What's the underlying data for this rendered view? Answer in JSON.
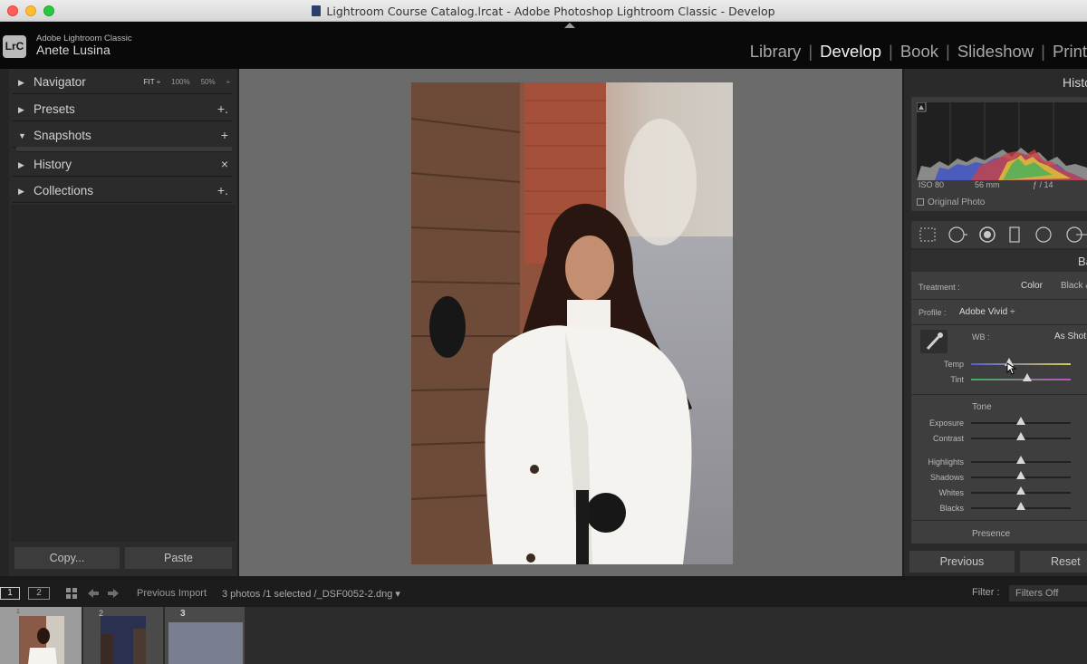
{
  "window": {
    "title": "Lightroom Course Catalog.lrcat - Adobe Photoshop Lightroom Classic - Develop"
  },
  "app": {
    "logo": "LrC",
    "name": "Adobe Lightroom Classic",
    "user": "Anete Lusina"
  },
  "modules": {
    "library": "Library",
    "develop": "Develop",
    "book": "Book",
    "slideshow": "Slideshow",
    "print": "Print",
    "active": "Develop"
  },
  "left_panel": {
    "navigator": {
      "label": "Navigator",
      "fit": "FIT ÷",
      "zoom_100": "100%",
      "zoom_50": "50%",
      "arrow": "÷"
    },
    "presets": {
      "label": "Presets",
      "action": "+."
    },
    "snapshots": {
      "label": "Snapshots",
      "action": "+"
    },
    "history": {
      "label": "History",
      "action": "×"
    },
    "collections": {
      "label": "Collections",
      "action": "+."
    },
    "copy_label": "Copy...",
    "paste_label": "Paste"
  },
  "right_panel": {
    "histogram_title": "Histogram",
    "meta": {
      "iso": "ISO 80",
      "focal": "56 mm",
      "aperture": "ƒ / 14"
    },
    "original_photo": "Original Photo",
    "basic_title": "Basic",
    "treatment": {
      "label": "Treatment :",
      "color": "Color",
      "bw": "Black & White"
    },
    "profile": {
      "label": "Profile :",
      "value": "Adobe Vivid ÷"
    },
    "wb": {
      "label": "WB :",
      "value": "As Shot"
    },
    "tone_label": "Tone",
    "presence_label": "Presence",
    "sliders": [
      {
        "label": "Temp",
        "value": 0.38
      },
      {
        "label": "Tint",
        "value": 0.56
      },
      {
        "label": "Exposure",
        "value": 0.5
      },
      {
        "label": "Contrast",
        "value": 0.5
      },
      {
        "label": "Highlights",
        "value": 0.5
      },
      {
        "label": "Shadows",
        "value": 0.5
      },
      {
        "label": "Whites",
        "value": 0.5
      },
      {
        "label": "Blacks",
        "value": 0.5
      }
    ],
    "previous_label": "Previous",
    "reset_label": "Reset"
  },
  "filmstrip": {
    "view1": "1",
    "view2": "2",
    "source": "Previous Import",
    "info": "3 photos /1 selected /_DSF0052-2.dng ▾",
    "filter_label": "Filter :",
    "filter_value": "Filters Off",
    "thumbs": [
      "1",
      "2",
      "3"
    ]
  },
  "colors": {
    "accent_active_module": "#f2f2f2",
    "panel_bg": "#2b2b2b",
    "center_bg": "#6b6b6b"
  },
  "icons": {
    "close": "traffic-light-red",
    "minimize": "traffic-light-yellow",
    "zoom": "traffic-light-green"
  }
}
